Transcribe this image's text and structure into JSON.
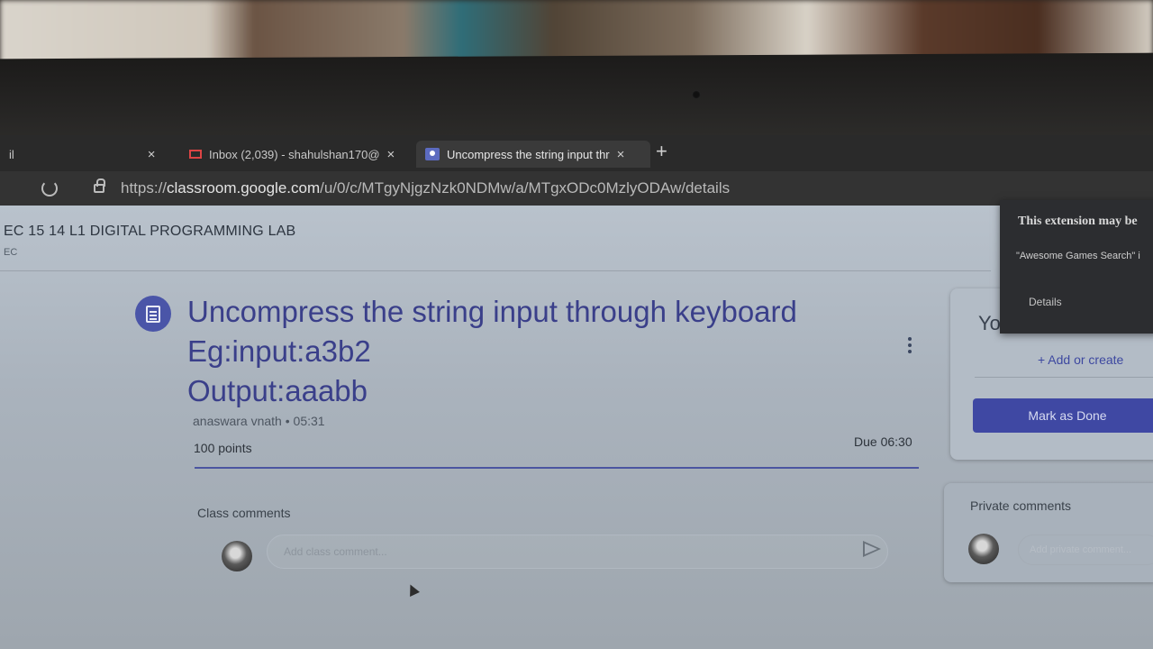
{
  "browser": {
    "tabs": [
      {
        "label": "il"
      },
      {
        "label": "Inbox (2,039) - shahulshan170@"
      },
      {
        "label": "Uncompress the string input thr"
      }
    ],
    "url_prefix": "https://",
    "url_domain": "classroom.google.com",
    "url_path": "/u/0/c/MTgyNjgzNzk0NDMw/a/MTgxODc0MzlyODAw/details"
  },
  "classroom": {
    "class_title": "EC 15 14 L1 DIGITAL PROGRAMMING LAB",
    "class_section": "EC"
  },
  "assignment": {
    "title_lines": [
      "Uncompress the string input through keyboard",
      "Eg:input:a3b2",
      "Output:aaabb"
    ],
    "author": "anaswara vnath",
    "separator": "•",
    "posted_time": "05:31",
    "points": "100 points",
    "due": "Due 06:30"
  },
  "comments": {
    "label": "Class comments",
    "placeholder": "Add class comment..."
  },
  "your_work": {
    "title": "Yo",
    "add_or_create": "+ Add or create",
    "mark_done": "Mark as Done"
  },
  "private_comments": {
    "label": "Private comments",
    "placeholder": "Add private comment..."
  },
  "extension_popup": {
    "title": "This extension may be",
    "body": "\"Awesome Games Search\" i",
    "details": "Details"
  },
  "colors": {
    "accent": "#3f48a3",
    "title_text": "#3a3f8a"
  }
}
